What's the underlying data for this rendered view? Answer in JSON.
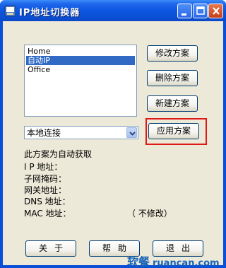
{
  "window": {
    "title": "IP地址切换器",
    "accent_color": "#0a4fd8"
  },
  "schemes": {
    "items": [
      {
        "label": "Home",
        "selected": false
      },
      {
        "label": "自动IP",
        "selected": true
      },
      {
        "label": "Office",
        "selected": false
      }
    ]
  },
  "buttons": {
    "edit": "修改方案",
    "delete": "删除方案",
    "new": "新建方案",
    "apply": "应用方案",
    "about": "关于",
    "help": "帮助",
    "exit": "退出"
  },
  "connection": {
    "selected": "本地连接"
  },
  "info": {
    "mode_text": "此方案为自动获取",
    "ip_label": "I P 地址：",
    "subnet_label": "子网掩码：",
    "gateway_label": "网关地址：",
    "dns_label": "DNS 地址：",
    "mac_label": "MAC 地址：",
    "mac_value": "（ 不修改）"
  },
  "watermark": {
    "cn": "软餐",
    "url": "ruancan.com"
  }
}
